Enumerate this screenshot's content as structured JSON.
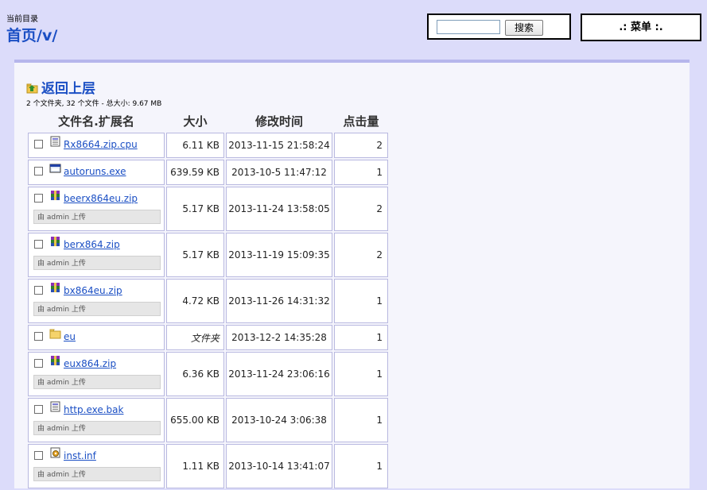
{
  "header": {
    "current_dir_label": "当前目录",
    "breadcrumb": {
      "home": "首页",
      "sep": "/",
      "dir": "v",
      "trail": "/"
    }
  },
  "search": {
    "button_label": "搜索",
    "value": ""
  },
  "menu": {
    "label": ".: 菜单 :."
  },
  "back": {
    "label": "返回上层"
  },
  "summary": "2 个文件夹, 32 个文件 - 总大小: 9.67 MB",
  "columns": {
    "name": "文件名.扩展名",
    "size": "大小",
    "time": "修改时间",
    "hits": "点击量"
  },
  "files": [
    {
      "name": "Rx8664.zip.cpu",
      "icon": "generic-file-icon",
      "size": "6.11 KB",
      "time": "2013-11-15 21:58:24",
      "hits": "2",
      "uploader": ""
    },
    {
      "name": "autoruns.exe",
      "icon": "executable-icon",
      "size": "639.59 KB",
      "time": "2013-10-5 11:47:12",
      "hits": "1",
      "uploader": ""
    },
    {
      "name": "beerx864eu.zip",
      "icon": "archive-icon",
      "size": "5.17 KB",
      "time": "2013-11-24 13:58:05",
      "hits": "2",
      "uploader": "由 admin 上传"
    },
    {
      "name": "berx864.zip",
      "icon": "archive-icon",
      "size": "5.17 KB",
      "time": "2013-11-19 15:09:35",
      "hits": "2",
      "uploader": "由 admin 上传"
    },
    {
      "name": "bx864eu.zip",
      "icon": "archive-icon",
      "size": "4.72 KB",
      "time": "2013-11-26 14:31:32",
      "hits": "1",
      "uploader": "由 admin 上传"
    },
    {
      "name": "eu",
      "icon": "folder-icon",
      "size": "文件夹",
      "time": "2013-12-2 14:35:28",
      "hits": "1",
      "uploader": ""
    },
    {
      "name": "eux864.zip",
      "icon": "archive-icon",
      "size": "6.36 KB",
      "time": "2013-11-24 23:06:16",
      "hits": "1",
      "uploader": "由 admin 上传"
    },
    {
      "name": "http.exe.bak",
      "icon": "generic-file-icon",
      "size": "655.00 KB",
      "time": "2013-10-24 3:06:38",
      "hits": "1",
      "uploader": "由 admin 上传"
    },
    {
      "name": "inst.inf",
      "icon": "settings-file-icon",
      "size": "1.11 KB",
      "time": "2013-10-14 13:41:07",
      "hits": "1",
      "uploader": "由 admin 上传"
    }
  ]
}
